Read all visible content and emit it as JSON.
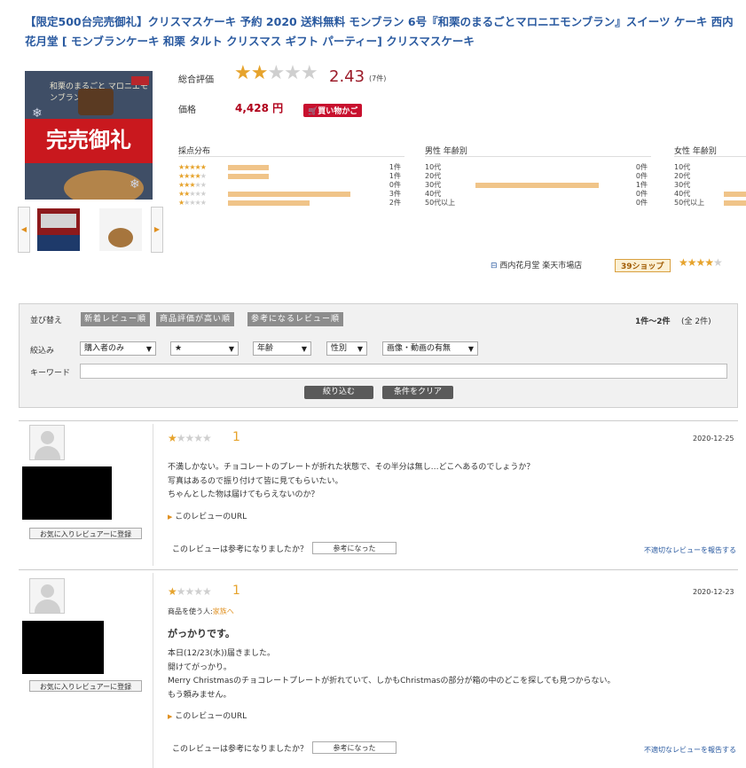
{
  "product": {
    "title": "【限定500台完売御礼】クリスマスケーキ 予約 2020 送料無料 モンブラン 6号『和栗のまるごとマロニエモンブラン』スイーツ ケーキ 西内花月堂 [ モンブランケーキ 和栗 タルト クリスマス ギフト パーティー] クリスマスケーキ",
    "image_banner": "完売御礼",
    "image_caption": "和栗のまるごと マロニエモンブラン",
    "rating_label": "総合評価",
    "rating_value": "2.43",
    "rating_count": "(7件)",
    "rating_stars_on": 2,
    "price_label": "価格",
    "price": "4,428 円",
    "cart_button": "買い物かご"
  },
  "distribution": {
    "score_header": "採点分布",
    "male_header": "男性 年齢別",
    "female_header": "女性 年齢別",
    "scores": [
      {
        "stars": 5,
        "count": "1件",
        "ratio": 0.33
      },
      {
        "stars": 4,
        "count": "1件",
        "ratio": 0.33
      },
      {
        "stars": 3,
        "count": "0件",
        "ratio": 0
      },
      {
        "stars": 2,
        "count": "3件",
        "ratio": 1.0
      },
      {
        "stars": 1,
        "count": "2件",
        "ratio": 0.67
      }
    ],
    "male": [
      {
        "age": "10代",
        "count": "0件",
        "ratio": 0
      },
      {
        "age": "20代",
        "count": "0件",
        "ratio": 0
      },
      {
        "age": "30代",
        "count": "1件",
        "ratio": 1.0
      },
      {
        "age": "40代",
        "count": "0件",
        "ratio": 0
      },
      {
        "age": "50代以上",
        "count": "0件",
        "ratio": 0
      }
    ],
    "female": [
      {
        "age": "10代"
      },
      {
        "age": "20代"
      },
      {
        "age": "30代"
      },
      {
        "age": "40代"
      },
      {
        "age": "50代以上"
      }
    ]
  },
  "shop": {
    "name": "西内花月堂 楽天市場店",
    "badge": "39ショップ",
    "stars_on": 4
  },
  "filters": {
    "sort_label": "並び替え",
    "sort_options": [
      "新着レビュー順",
      "商品評価が高い順",
      "参考になるレビュー順"
    ],
    "result_range": "1件～2件",
    "result_total": "(全 2件)",
    "narrow_label": "絞込み",
    "purchaser": "購入者のみ",
    "stars": "★",
    "age": "年齢",
    "gender": "性別",
    "media": "画像・動画の有無",
    "keyword_label": "キーワード",
    "keyword_value": "",
    "apply_button": "絞り込む",
    "clear_button": "条件をクリア"
  },
  "reviews": [
    {
      "stars_on": 1,
      "score": "1",
      "date": "2020-12-25",
      "lines": [
        "不満しかない。チョコレートのプレートが折れた状態で、その半分は無し…どこへあるのでしょうか？",
        "写真はあるので振り付けて皆に見てもらいたい。",
        "ちゃんとした物は届けてもらえないのか？"
      ],
      "link": "このレビューのURL",
      "fav_button": "お気に入りレビュアーに登録",
      "helpful_q": "このレビューは参考になりましたか？",
      "helpful_button": "参考になった",
      "report": "不適切なレビューを報告する"
    },
    {
      "stars_on": 1,
      "score": "1",
      "date": "2020-12-23",
      "meta_label": "商品を使う人:",
      "meta_value": "家族へ",
      "title": "がっかりです。",
      "lines": [
        "本日(12/23(水))届きました。",
        "開けてがっかり。",
        "Merry Christmasのチョコレートプレートが折れていて、しかもChristmasの部分が箱の中のどこを探しても見つからない。",
        "もう頼みません。"
      ],
      "link": "このレビューのURL",
      "fav_button": "お気に入りレビュアーに登録",
      "helpful_q": "このレビューは参考になりましたか？",
      "helpful_button": "参考になった",
      "report": "不適切なレビューを報告する"
    }
  ],
  "colors": {
    "title_blue": "#2a5aa0",
    "star_gold": "#e6a32c",
    "price_red": "#b0001a",
    "bar_fill": "#f0c489"
  }
}
